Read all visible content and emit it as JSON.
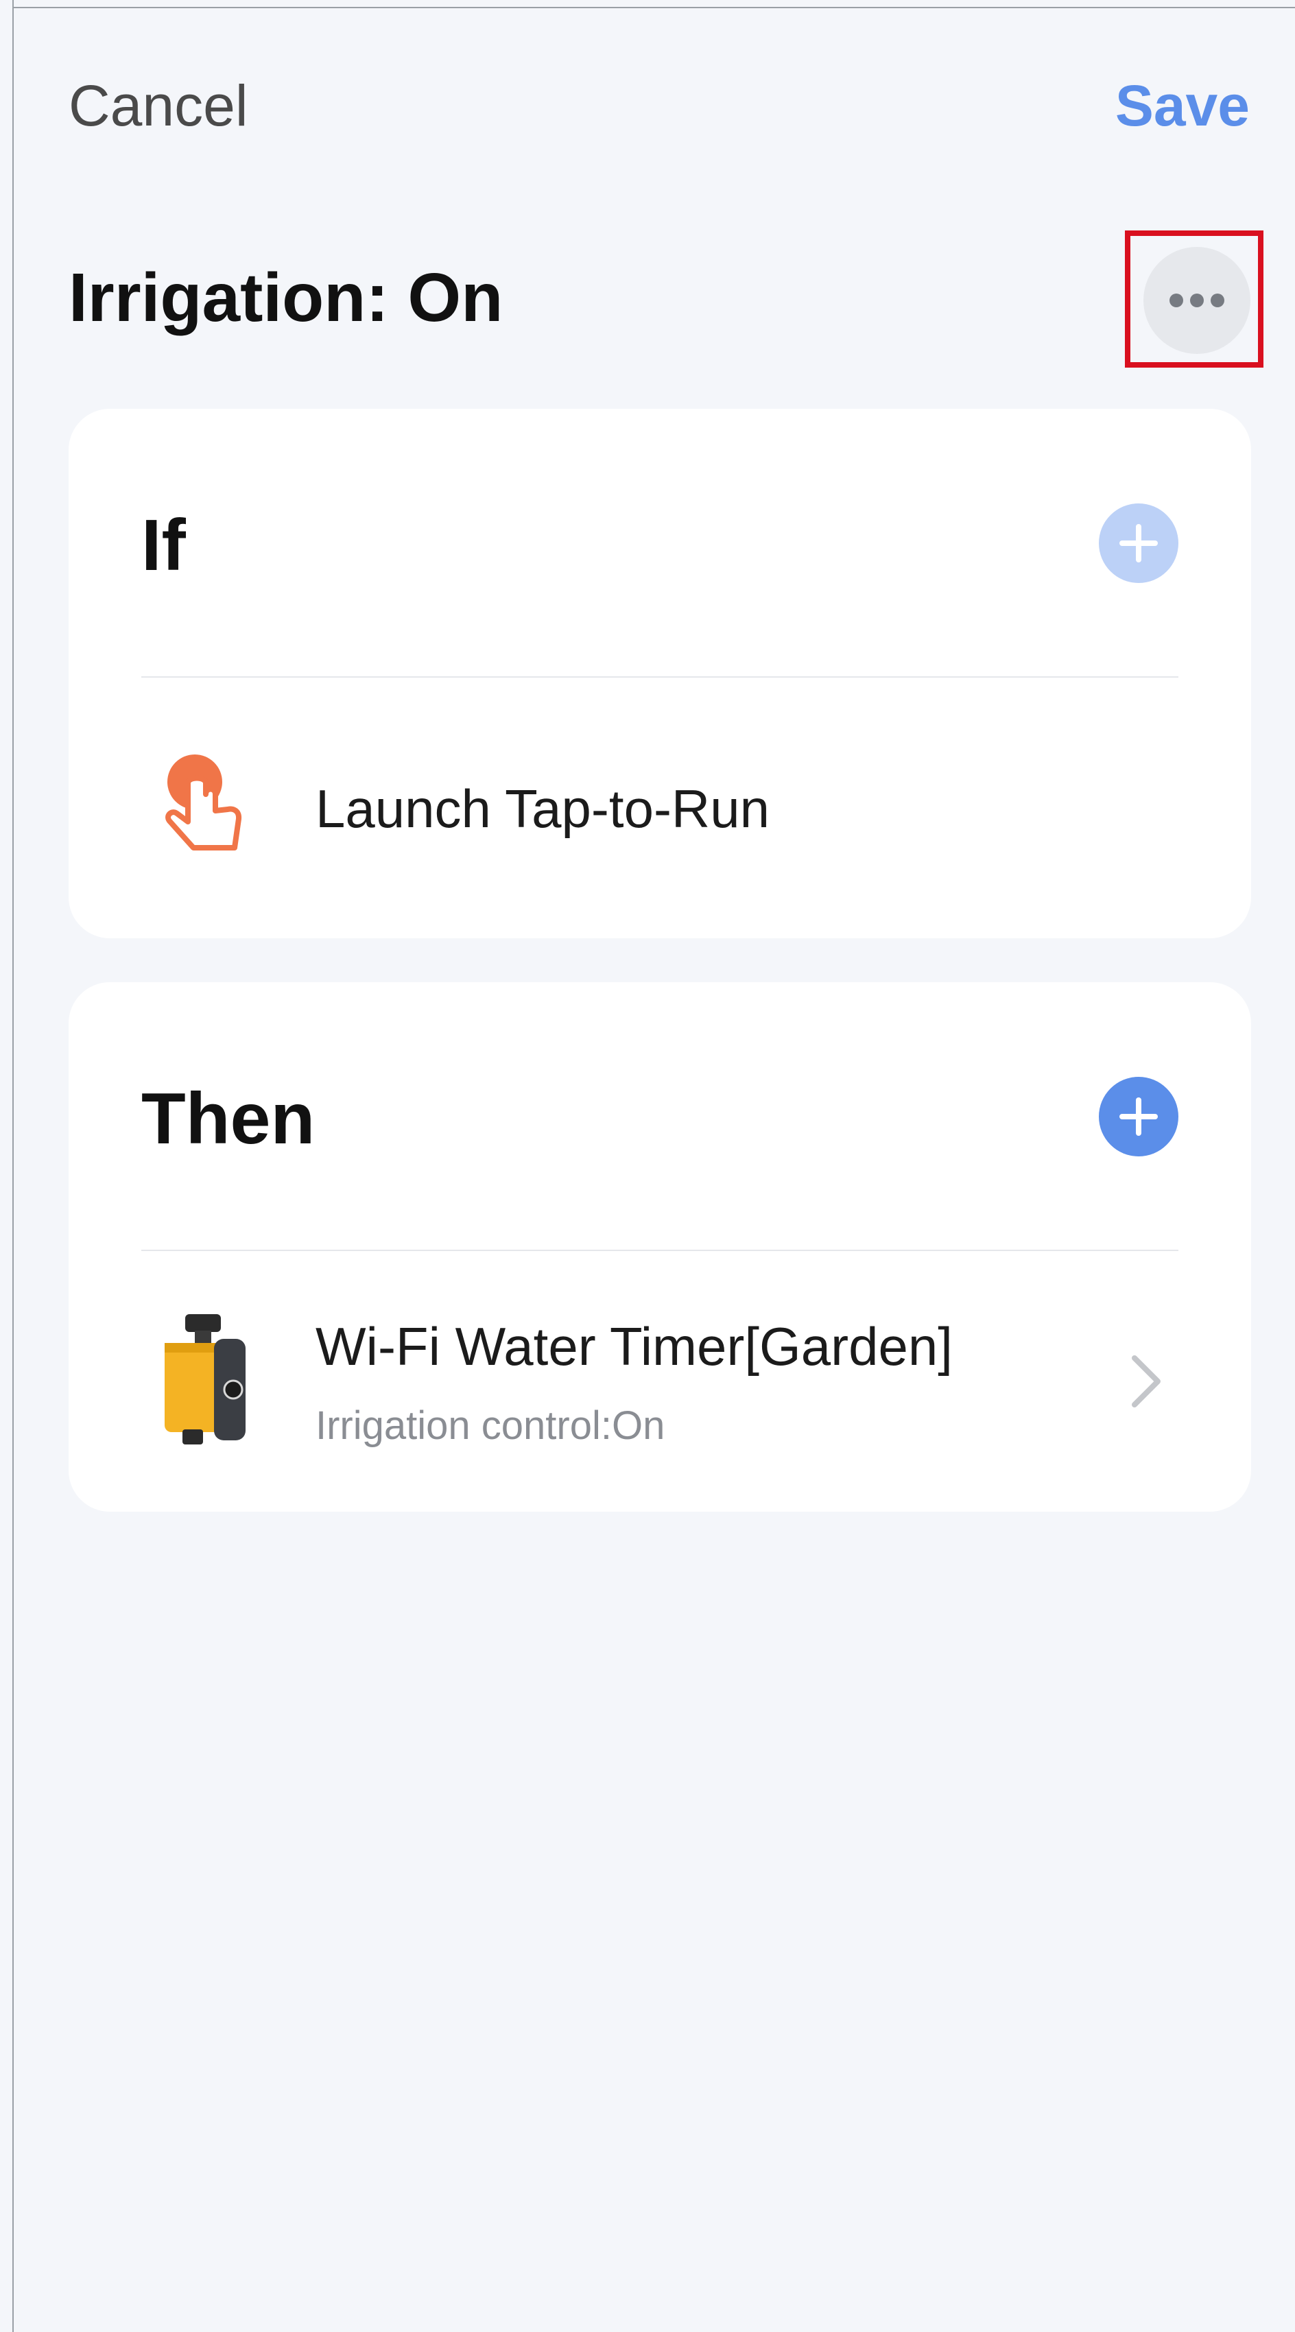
{
  "header": {
    "cancel_label": "Cancel",
    "save_label": "Save",
    "title": "Irrigation: On",
    "more_icon": "more-horizontal-icon"
  },
  "if_card": {
    "heading": "If",
    "add_icon": "plus-icon",
    "condition": {
      "icon": "tap-hand-icon",
      "label": "Launch Tap-to-Run"
    }
  },
  "then_card": {
    "heading": "Then",
    "add_icon": "plus-icon",
    "action": {
      "icon": "water-timer-device-image",
      "title": "Wi-Fi Water Timer[Garden]",
      "subtitle": "Irrigation control:On",
      "chevron_icon": "chevron-right-icon"
    }
  },
  "colors": {
    "accent": "#5b8ee9",
    "accent_disabled": "#bcd1f7",
    "background": "#f4f6fa",
    "highlight": "#d9101f",
    "tap_icon": "#f07548"
  }
}
